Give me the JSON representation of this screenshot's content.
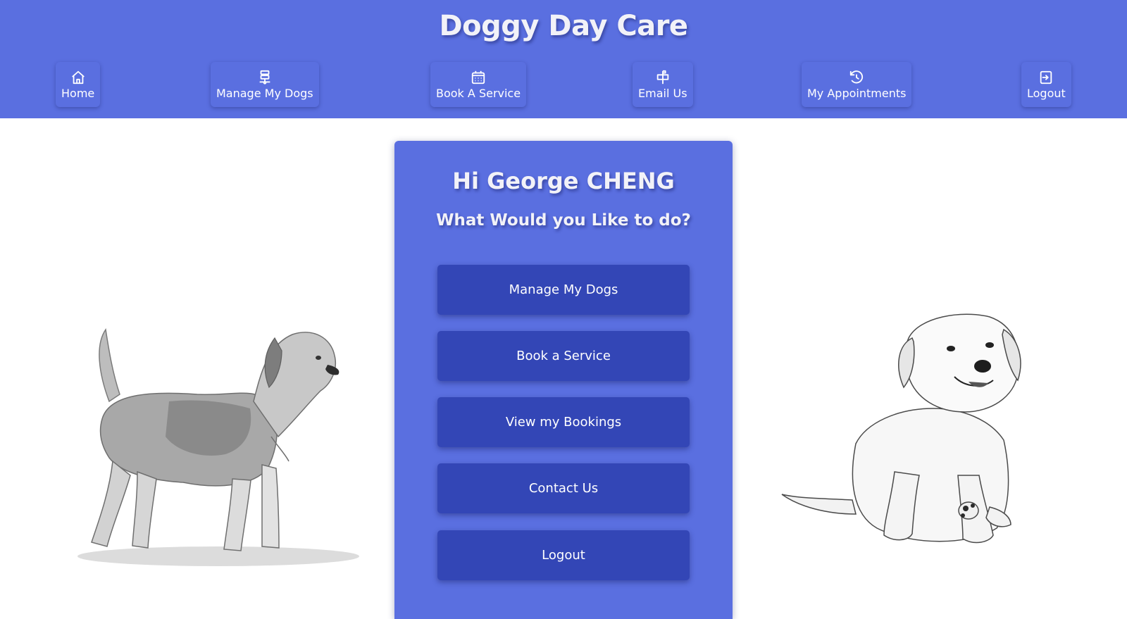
{
  "header": {
    "title": "Doggy Day Care",
    "nav": [
      {
        "label": "Home",
        "icon": "home-icon"
      },
      {
        "label": "Manage My Dogs",
        "icon": "dogs-icon"
      },
      {
        "label": "Book A Service",
        "icon": "calendar-icon"
      },
      {
        "label": "Email Us",
        "icon": "mailbox-icon"
      },
      {
        "label": "My Appointments",
        "icon": "history-icon"
      },
      {
        "label": "Logout",
        "icon": "logout-icon"
      }
    ]
  },
  "main": {
    "greeting": "Hi George CHENG",
    "prompt": "What Would you Like to do?",
    "actions": [
      {
        "label": "Manage My Dogs"
      },
      {
        "label": "Book a Service"
      },
      {
        "label": "View my Bookings"
      },
      {
        "label": "Contact Us"
      },
      {
        "label": "Logout"
      }
    ]
  },
  "illustrations": {
    "left": "beagle-sketch",
    "right": "puppy-sketch"
  },
  "colors": {
    "primary": "#5a6fe0",
    "button": "#3346b6",
    "background": "#ffffff",
    "text": "#ffffff"
  }
}
